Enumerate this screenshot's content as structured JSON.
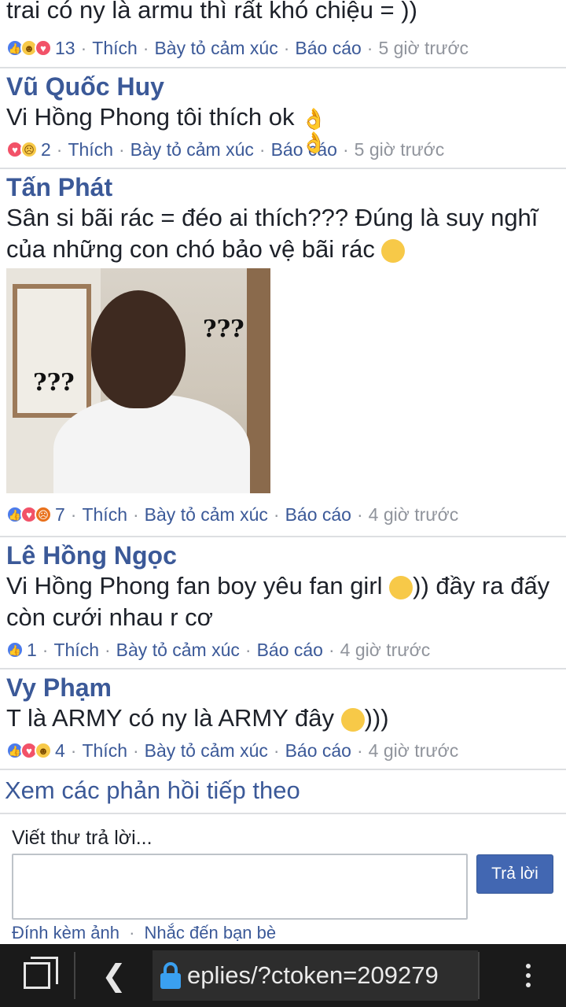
{
  "comments": [
    {
      "author": "",
      "body": "trai có ny là armu thì rất khó chiệu = ))",
      "reactions": [
        "like",
        "haha",
        "love"
      ],
      "count": "13",
      "time": "5 giờ trước"
    },
    {
      "author": "Vũ Quốc Huy",
      "body": "Vi Hồng Phong tôi thích ok",
      "body_emoji": "👌 👌",
      "reactions": [
        "love",
        "sad"
      ],
      "count": "2",
      "time": "5 giờ trước"
    },
    {
      "author": "Tấn Phát",
      "body": "Sân si bãi rác = đéo ai thích??? Đúng là suy nghĩ của những con chó bảo vệ bãi rác",
      "image_text": [
        "???",
        "???"
      ],
      "reactions": [
        "like",
        "love",
        "angry"
      ],
      "count": "7",
      "time": "4 giờ trước"
    },
    {
      "author": "Lê Hồng Ngọc",
      "body_before": "Vi Hồng Phong fan boy yêu fan girl",
      "body_after": ")) đầy ra đấy còn cưới nhau r cơ",
      "reactions": [
        "like"
      ],
      "count": "1",
      "time": "4 giờ trước"
    },
    {
      "author": "Vy Phạm",
      "body_before": "T là ARMY có ny là ARMY đây",
      "body_after": ")))",
      "reactions": [
        "like",
        "love",
        "haha"
      ],
      "count": "4",
      "time": "4 giờ trước"
    }
  ],
  "actions": {
    "like": "Thích",
    "react": "Bày tỏ cảm xúc",
    "report": "Báo cáo",
    "separator": "·"
  },
  "more_replies": "Xem các phản hồi tiếp theo",
  "reply": {
    "label": "Viết thư trả lời...",
    "send": "Trả lời",
    "attach_photo": "Đính kèm ảnh",
    "mention_friends": "Nhắc đến bạn bè"
  },
  "browser": {
    "url": "eplies/?ctoken=209279",
    "icons": [
      "tabs-icon",
      "back-icon",
      "lock-icon",
      "more-vert-icon"
    ],
    "lock_color": "#3aa0f0"
  },
  "colors": {
    "link": "#3b5998",
    "meta": "#90949c",
    "button": "#4267b2"
  }
}
